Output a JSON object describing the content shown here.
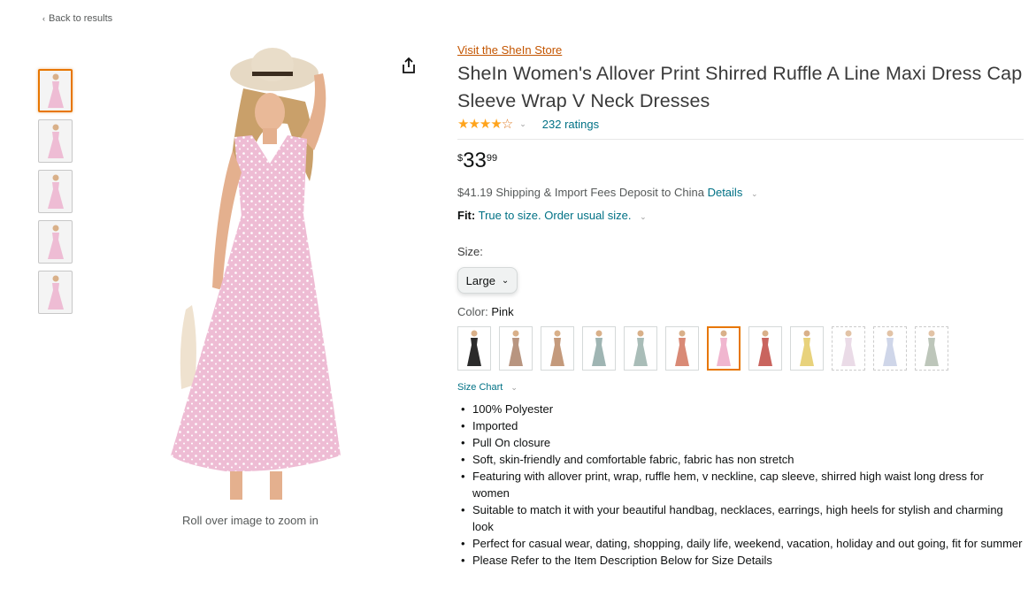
{
  "nav": {
    "back_label": "Back to results"
  },
  "gallery": {
    "thumbnails": [
      "thumb-1",
      "thumb-2",
      "thumb-3",
      "thumb-4",
      "thumb-5"
    ],
    "active_index": 0,
    "zoom_hint": "Roll over image to zoom in",
    "main_dress_color": "#eebcd4"
  },
  "product": {
    "store_link": "Visit the SheIn Store",
    "title": "SheIn Women's Allover Print Shirred Ruffle A Line Maxi Dress Cap Sleeve Wrap V Neck Dresses",
    "rating": {
      "stars": 3.5,
      "count_label": "232 ratings"
    },
    "price": {
      "symbol": "$",
      "whole": "33",
      "fraction": "99"
    },
    "shipping": {
      "text": "$41.19 Shipping & Import Fees Deposit to China",
      "details_label": "Details"
    },
    "fit": {
      "label": "Fit:",
      "value": "True to size. Order usual size."
    },
    "size": {
      "label": "Size:",
      "selected": "Large"
    },
    "color": {
      "label": "Color:",
      "selected": "Pink"
    },
    "size_chart_label": "Size Chart",
    "bullets": [
      "100% Polyester",
      "Imported",
      "Pull On closure",
      "Soft, skin-friendly and comfortable fabric, fabric has non stretch",
      "Featuring with allover print, wrap, ruffle hem, v neckline, cap sleeve, shirred high waist long dress for women",
      "Suitable to match it with your beautiful handbag, necklaces, earrings, high heels for stylish and charming look",
      "Perfect for casual wear, dating, shopping, daily life, weekend, vacation, holiday and out going, fit for summer",
      "Please Refer to the Item Description Below for Size Details"
    ]
  },
  "swatches": [
    {
      "color": "#2b2b2b",
      "selected": false,
      "available": true
    },
    {
      "color": "#b89580",
      "selected": false,
      "available": true
    },
    {
      "color": "#c49a7c",
      "selected": false,
      "available": true
    },
    {
      "color": "#9fb5b3",
      "selected": false,
      "available": true
    },
    {
      "color": "#a9bdb8",
      "selected": false,
      "available": true
    },
    {
      "color": "#d98a76",
      "selected": false,
      "available": true
    },
    {
      "color": "#f0b6cf",
      "selected": true,
      "available": true
    },
    {
      "color": "#c9645e",
      "selected": false,
      "available": true
    },
    {
      "color": "#e8d27c",
      "selected": false,
      "available": true
    },
    {
      "color": "#e3cfe0",
      "selected": false,
      "available": false
    },
    {
      "color": "#bfc9e2",
      "selected": false,
      "available": false
    },
    {
      "color": "#a7b4a3",
      "selected": false,
      "available": false
    }
  ]
}
